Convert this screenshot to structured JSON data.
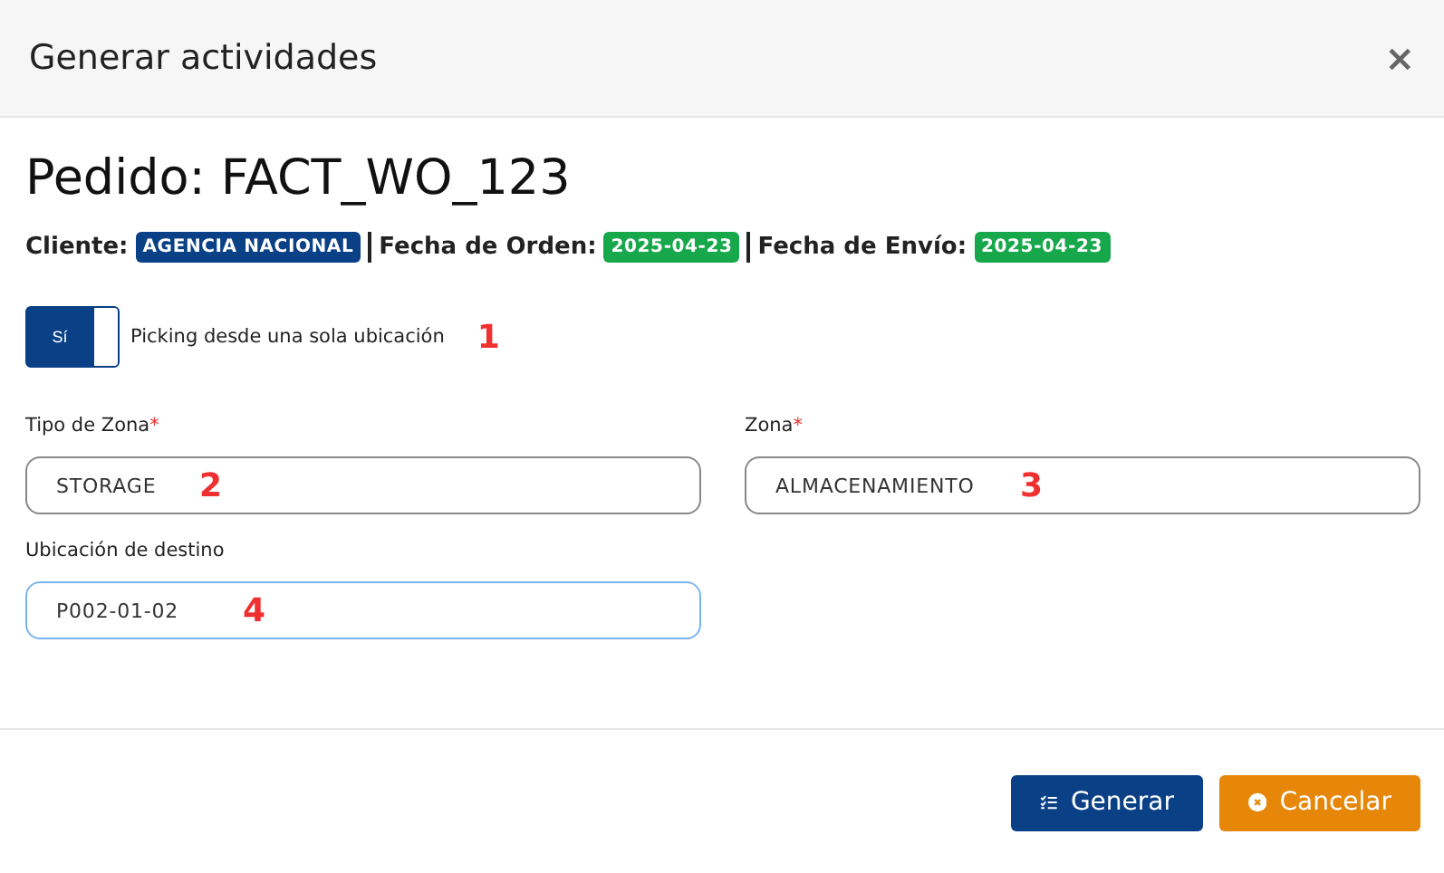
{
  "window": {
    "title": "Generar actividades",
    "close": "×"
  },
  "order": {
    "heading": "Pedido: FACT_WO_123",
    "meta": [
      {
        "label": "Cliente:",
        "badge": "AGENCIA NACIONAL",
        "color": "#0a4086"
      },
      {
        "label": "Fecha de Orden:",
        "badge": "2025-04-23",
        "color": "#17a84b"
      },
      {
        "label": "Fecha de Envío:",
        "badge": "2025-04-23",
        "color": "#17a84b"
      }
    ]
  },
  "toggle": {
    "label": "Sí",
    "on": true,
    "caption": "Picking desde una sola ubicación",
    "annotation": "1"
  },
  "fields": [
    {
      "label": "Tipo de Zona",
      "required_mark": "*",
      "value": "STORAGE",
      "focused": false,
      "annotation": "2"
    },
    {
      "label": "Zona",
      "required_mark": "*",
      "value": "ALMACENAMIENTO",
      "focused": false,
      "annotation": "3"
    },
    {
      "label": "Ubicación de destino",
      "value": "P002-01-02",
      "focused": true,
      "annotation": "4"
    }
  ],
  "buttons": [
    {
      "kind": "primary",
      "label": "Generar"
    },
    {
      "kind": "cancel",
      "label": "Cancelar"
    }
  ]
}
